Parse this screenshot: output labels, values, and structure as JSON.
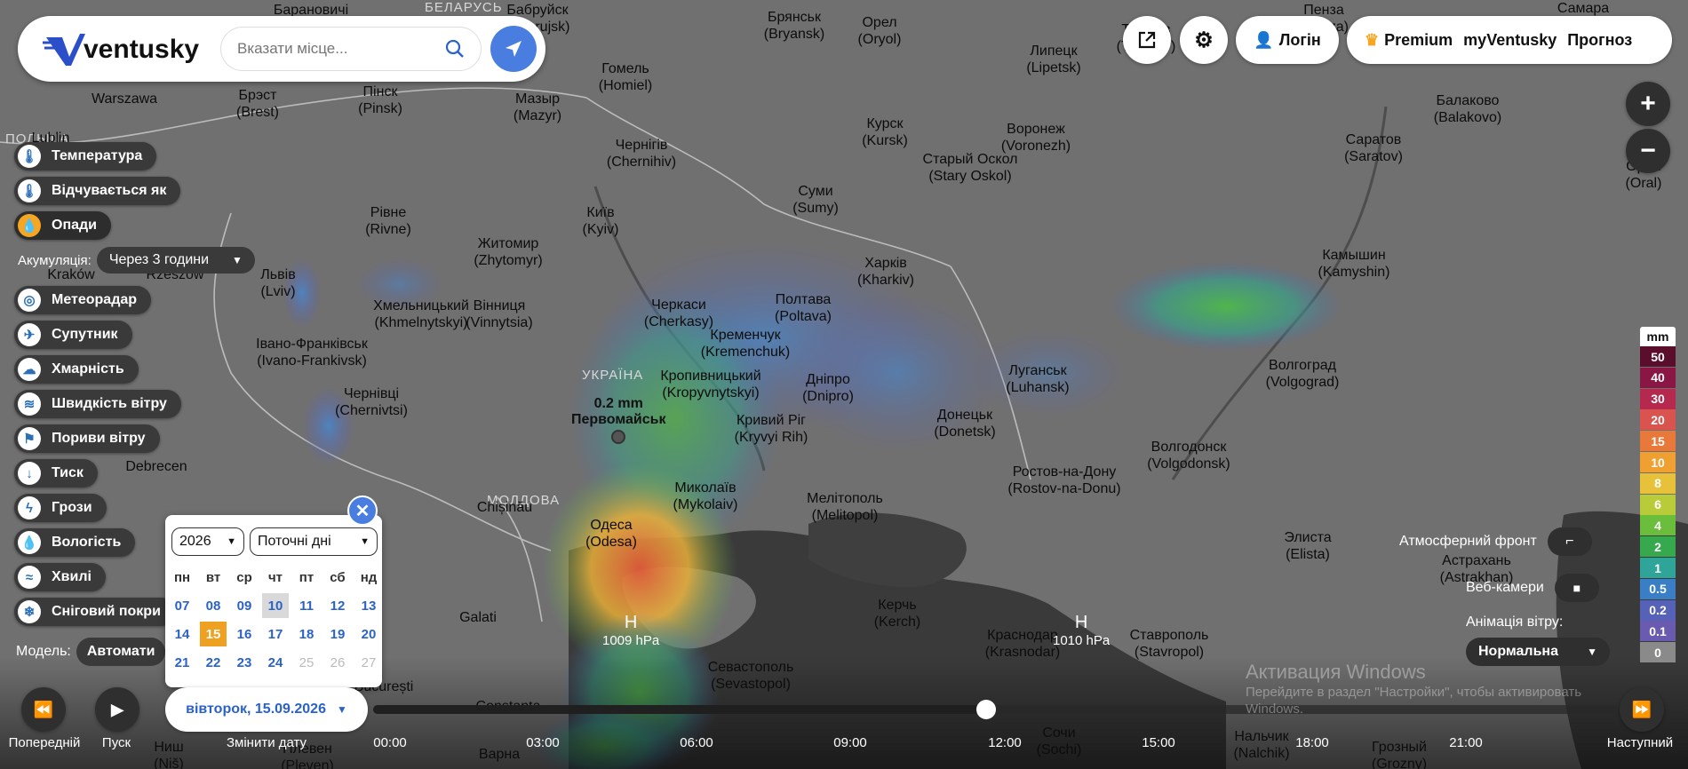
{
  "header": {
    "logo_text": "ventusky",
    "search_placeholder": "Вказати місце...",
    "login_label": "Логін",
    "premium_label": "Premium",
    "myventusky_label": "myVentusky",
    "forecast_label": "Прогноз"
  },
  "layers": [
    {
      "label": "Температура",
      "icon": "thermometer-icon",
      "glyph": "🌡"
    },
    {
      "label": "Відчувається як",
      "icon": "feels-like-icon",
      "glyph": "🌡"
    },
    {
      "label": "Опади",
      "icon": "precipitation-icon",
      "glyph": "💧",
      "active": true
    },
    {
      "label": "Метеорадар",
      "icon": "radar-icon",
      "glyph": "◎"
    },
    {
      "label": "Супутник",
      "icon": "satellite-icon",
      "glyph": "✈"
    },
    {
      "label": "Хмарність",
      "icon": "cloud-icon",
      "glyph": "☁"
    },
    {
      "label": "Швидкість вітру",
      "icon": "wind-icon",
      "glyph": "≋"
    },
    {
      "label": "Пориви вітру",
      "icon": "wind-gust-icon",
      "glyph": "⚑"
    },
    {
      "label": "Тиск",
      "icon": "pressure-icon",
      "glyph": "↓"
    },
    {
      "label": "Грози",
      "icon": "lightning-icon",
      "glyph": "ϟ"
    },
    {
      "label": "Вологість",
      "icon": "humidity-icon",
      "glyph": "💧"
    },
    {
      "label": "Хвилі",
      "icon": "waves-icon",
      "glyph": "≈"
    },
    {
      "label": "Сніговий покри",
      "icon": "snow-icon",
      "glyph": "❄"
    }
  ],
  "accumulation": {
    "label": "Акумуляція:",
    "value": "Через 3 години"
  },
  "model": {
    "label": "Модель:",
    "value": "Автомати"
  },
  "calendar": {
    "year": "2026",
    "mode": "Поточні дні",
    "weekdays": [
      "пн",
      "вт",
      "ср",
      "чт",
      "пт",
      "сб",
      "нд"
    ],
    "weeks": [
      [
        "07",
        "08",
        "09",
        "10",
        "11",
        "12",
        "13"
      ],
      [
        "14",
        "15",
        "16",
        "17",
        "18",
        "19",
        "20"
      ],
      [
        "21",
        "22",
        "23",
        "24",
        "25",
        "26",
        "27"
      ]
    ],
    "selected_day": "15",
    "today_day": "10",
    "disabled_days": [
      "25",
      "26",
      "27"
    ],
    "date_label": "вівторок, 15.09.2026"
  },
  "timeline": {
    "prev_label": "Попередній",
    "play_label": "Пуск",
    "change_date_label": "Змінити дату",
    "next_label": "Наступний",
    "times": [
      "00:00",
      "03:00",
      "06:00",
      "09:00",
      "12:00",
      "15:00",
      "18:00",
      "21:00"
    ],
    "progress": 0.5
  },
  "legend": {
    "unit": "mm",
    "items": [
      {
        "v": "50",
        "c": "#5a0e2c"
      },
      {
        "v": "40",
        "c": "#8a1645"
      },
      {
        "v": "30",
        "c": "#b5294f"
      },
      {
        "v": "20",
        "c": "#d9534f"
      },
      {
        "v": "15",
        "c": "#e8793a"
      },
      {
        "v": "10",
        "c": "#f0a030"
      },
      {
        "v": "8",
        "c": "#e8c13a"
      },
      {
        "v": "6",
        "c": "#b8cc3a"
      },
      {
        "v": "4",
        "c": "#6bbd3c"
      },
      {
        "v": "2",
        "c": "#36a84d"
      },
      {
        "v": "1",
        "c": "#2fa59a"
      },
      {
        "v": "0.5",
        "c": "#3a7fc5"
      },
      {
        "v": "0.2",
        "c": "#5662b8"
      },
      {
        "v": "0.1",
        "c": "#6a5bb0"
      },
      {
        "v": "0",
        "c": "#8a8a8a"
      }
    ]
  },
  "right_panel": {
    "fronts_label": "Атмосферний фронт",
    "webcams_label": "Веб-камери",
    "wind_anim_label": "Анімація вітру:",
    "wind_anim_value": "Нормальна"
  },
  "point_marker": {
    "value": "0.2 mm",
    "city": "Первомайськ"
  },
  "pressure_centers": [
    {
      "letter": "H",
      "value": "1009 hPa"
    },
    {
      "letter": "H",
      "value": "1010 hPa"
    }
  ],
  "countries": [
    "БЕЛАРУСЬ",
    "ПОЛЬША",
    "УКРАЇНА",
    "МОЛДОВА"
  ],
  "cities": [
    [
      "Барановичі",
      ""
    ],
    [
      "Бабруйск",
      "(Babrujsk)"
    ],
    [
      "Брянськ",
      "(Bryansk)"
    ],
    [
      "Орел",
      "(Oryol)"
    ],
    [
      "Пенза",
      "(Penza)"
    ],
    [
      "Самара",
      ""
    ],
    [
      "Гомель",
      "(Homiel)"
    ],
    [
      "Липецк",
      "(Lipetsk)"
    ],
    [
      "Тамбов",
      "(Tambov)"
    ],
    [
      "Warszawa",
      ""
    ],
    [
      "Брэст",
      "(Brest)"
    ],
    [
      "Пінск",
      "(Pinsk)"
    ],
    [
      "Мазыр",
      "(Mazyr)"
    ],
    [
      "Курск",
      "(Kursk)"
    ],
    [
      "Воронеж",
      "(Voronezh)"
    ],
    [
      "Балаково",
      "(Balakovo)"
    ],
    [
      "Lublin",
      ""
    ],
    [
      "Чернігів",
      "(Chernihiv)"
    ],
    [
      "Старый Оскол",
      "(Stary Oskol)"
    ],
    [
      "Саратов",
      "(Saratov)"
    ],
    [
      "Орал",
      "(Oral)"
    ],
    [
      "Суми",
      "(Sumy)"
    ],
    [
      "Рівне",
      "(Rivne)"
    ],
    [
      "Київ",
      "(Kyiv)"
    ],
    [
      "Житомир",
      "(Zhytomyr)"
    ],
    [
      "Харків",
      "(Kharkiv)"
    ],
    [
      "Камышин",
      "(Kamyshin)"
    ],
    [
      "Львів",
      "(Lviv)"
    ],
    [
      "Kraków",
      ""
    ],
    [
      "Rzeszów",
      ""
    ],
    [
      "Хмельницький",
      "(Khmelnytskyi)"
    ],
    [
      "Вінниця",
      "(Vinnytsia)"
    ],
    [
      "Черкаси",
      "(Cherkasy)"
    ],
    [
      "Полтава",
      "(Poltava)"
    ],
    [
      "Кременчук",
      "(Kremenchuk)"
    ],
    [
      "Івано-Франківськ",
      "(Ivano-Frankivsk)"
    ],
    [
      "Кропивницький",
      "(Kropyvnytskyi)"
    ],
    [
      "Дніпро",
      "(Dnipro)"
    ],
    [
      "Луганськ",
      "(Luhansk)"
    ],
    [
      "Волгоград",
      "(Volgograd)"
    ],
    [
      "Чернівці",
      "(Chernivtsi)"
    ],
    [
      "Кривий Ріг",
      "(Kryvyi Rih)"
    ],
    [
      "Донецьк",
      "(Donetsk)"
    ],
    [
      "Волгодонск",
      "(Volgodonsk)"
    ],
    [
      "Debrecen",
      ""
    ],
    [
      "Chișinău",
      ""
    ],
    [
      "Миколаїв",
      "(Mykolaiv)"
    ],
    [
      "Ростов-на-Дону",
      "(Rostov-na-Donu)"
    ],
    [
      "Мелітополь",
      "(Melitopol)"
    ],
    [
      "Одеса",
      "(Odesa)"
    ],
    [
      "Элиста",
      "(Elista)"
    ],
    [
      "Астрахань",
      "(Astrakhan)"
    ],
    [
      "Galati",
      ""
    ],
    [
      "Керчь",
      "(Kerch)"
    ],
    [
      "Краснодар",
      "(Krasnodar)"
    ],
    [
      "Ставрополь",
      "(Stavropol)"
    ],
    [
      "Севастополь",
      "(Sevastopol)"
    ],
    [
      "București",
      ""
    ],
    [
      "Constanța",
      ""
    ],
    [
      "Сочи",
      "(Sochi)"
    ],
    [
      "Ниш",
      "(Niš)"
    ],
    [
      "Варна",
      ""
    ],
    [
      "Плевен",
      "(Pleven)"
    ],
    [
      "Нальчик",
      "(Nalchik)"
    ],
    [
      "Грозный",
      "(Grozny)"
    ]
  ],
  "windows_watermark": {
    "title": "Активация Windows",
    "subtitle": "Перейдите в раздел \"Настройки\", чтобы активировать Windows."
  }
}
